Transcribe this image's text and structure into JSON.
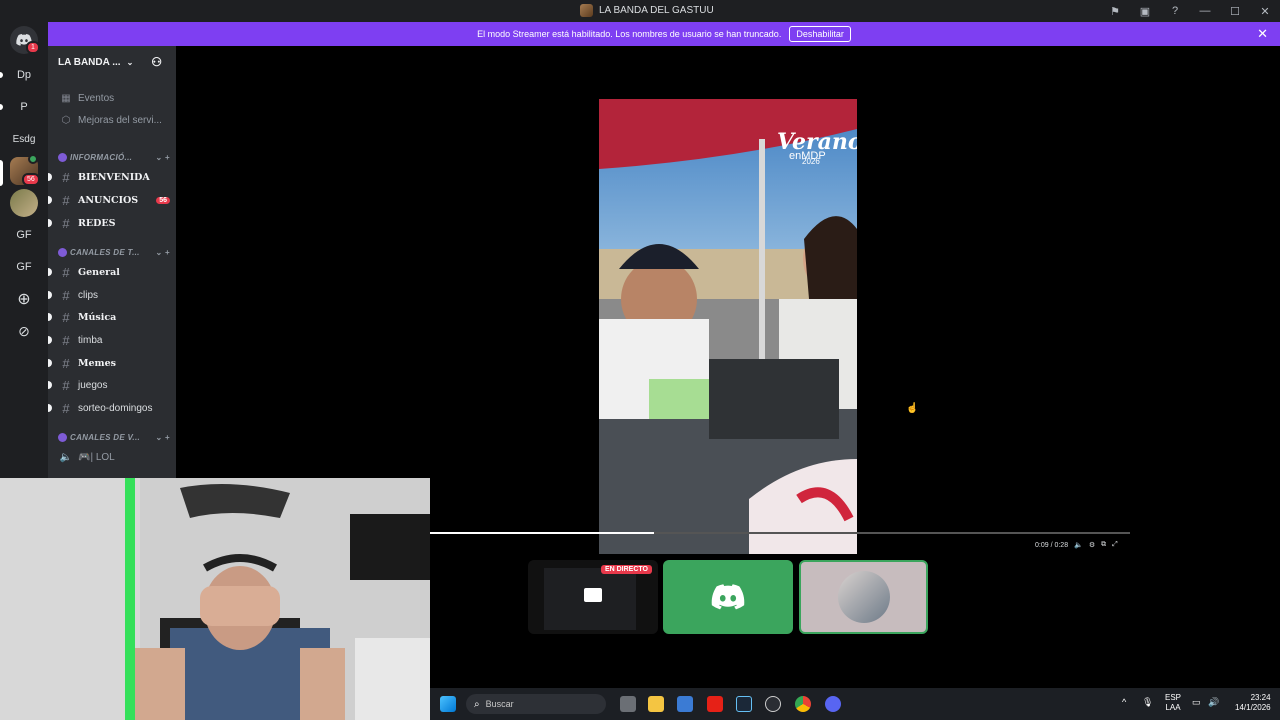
{
  "window": {
    "title": "LA BANDA DEL GASTUU"
  },
  "banner": {
    "message": "El modo Streamer está habilitado. Los nombres de usuario se han truncado.",
    "button_label": "Deshabilitar"
  },
  "guilds": {
    "home_badge": "1",
    "items": [
      {
        "label": "Dp"
      },
      {
        "label": "P"
      },
      {
        "label": "Esdg"
      },
      {
        "label": "GF"
      },
      {
        "label": "GF"
      }
    ],
    "server_badge": "56"
  },
  "sidebar": {
    "server_name": "LA BANDA ...",
    "top_items": [
      "Eventos",
      "Mejoras del servi..."
    ],
    "cat_info": "INFORMACIÓ...",
    "info_channels": [
      {
        "name": "BIENVENIDA"
      },
      {
        "name": "ANUNCIOS",
        "badge": "56"
      },
      {
        "name": "REDES"
      }
    ],
    "cat_text": "CANALES DE T...",
    "text_channels": [
      "General",
      "clips",
      "Música",
      "timba",
      "Memes",
      "juegos",
      "sorteo-domingos"
    ],
    "cat_voice": "CANALES DE V...",
    "voice_channels": [
      "🎮| LOL"
    ]
  },
  "video": {
    "overlay_title": "Verano!",
    "overlay_sub": "enMDP",
    "overlay_year": "2026",
    "time": "0:09 / 0:28",
    "progress": 0.32
  },
  "tiles": {
    "live_label": "EN DIRECTO"
  },
  "taskbar": {
    "search_placeholder": "Buscar",
    "lang_top": "ESP",
    "lang_bottom": "LAA",
    "time": "23:24",
    "date": "14/1/2026"
  },
  "colors": {
    "accent": "#7e3ff2",
    "discord_green": "#3ba55d",
    "danger": "#e8394b"
  }
}
